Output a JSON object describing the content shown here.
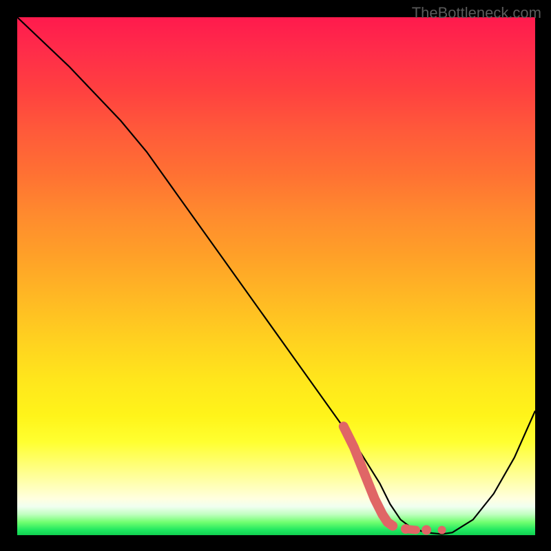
{
  "watermark": "TheBottleneck.com",
  "chart_data": {
    "type": "line",
    "title": "",
    "xlabel": "",
    "ylabel": "",
    "xlim": [
      0,
      100
    ],
    "ylim": [
      0,
      100
    ],
    "grid": false,
    "series": [
      {
        "name": "main-curve",
        "color": "#000000",
        "x": [
          0,
          10,
          20,
          25,
          30,
          40,
          50,
          60,
          65,
          70,
          72,
          74,
          76,
          78,
          80,
          82,
          84,
          88,
          92,
          96,
          100
        ],
        "y": [
          100,
          90.5,
          80,
          74,
          67,
          53,
          39,
          25,
          18,
          10,
          6,
          3,
          1.5,
          0.8,
          0.4,
          0.2,
          0.5,
          3,
          8,
          15,
          24
        ]
      },
      {
        "name": "highlight-segment",
        "color": "#e06666",
        "style": "thick-dotted",
        "x": [
          63,
          65,
          67,
          69,
          70.5,
          71.5,
          72.5,
          75,
          77,
          79,
          82
        ],
        "y": [
          21,
          17,
          12,
          7,
          4,
          2.5,
          1.8,
          1.2,
          1.0,
          1.0,
          1.0
        ]
      }
    ],
    "background_gradient": {
      "direction": "vertical",
      "stops": [
        {
          "pos": 0.0,
          "color": "#ff1a4d"
        },
        {
          "pos": 0.5,
          "color": "#ffb020"
        },
        {
          "pos": 0.8,
          "color": "#ffff30"
        },
        {
          "pos": 0.93,
          "color": "#ffffe0"
        },
        {
          "pos": 1.0,
          "color": "#10d050"
        }
      ]
    }
  }
}
